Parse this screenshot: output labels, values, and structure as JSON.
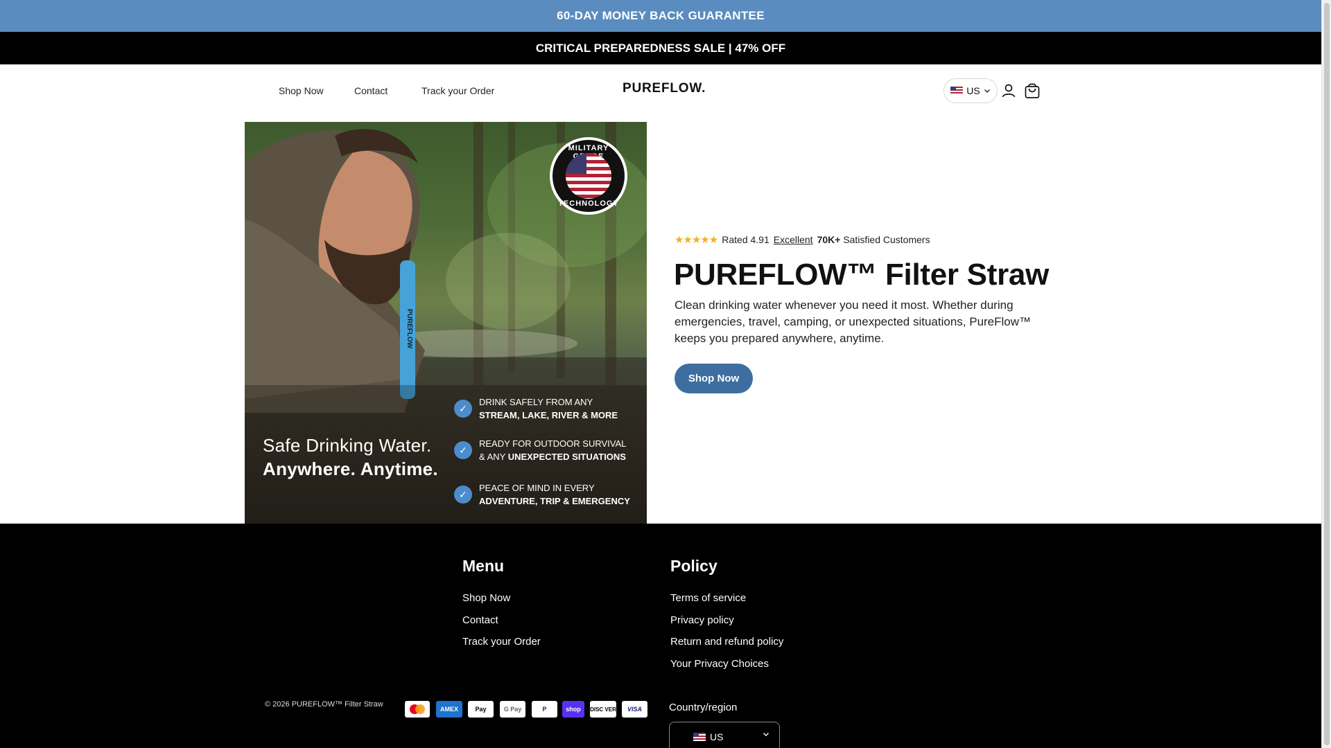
{
  "announcement": {
    "top": "60-DAY MONEY BACK GUARANTEE",
    "sale": "CRITICAL PREPAREDNESS SALE | 47% OFF"
  },
  "header": {
    "nav": [
      "Shop Now",
      "Contact",
      "Track your Order"
    ],
    "logo": "PUREFLOW.",
    "locale": "US",
    "icons": [
      "account-icon",
      "cart-icon"
    ]
  },
  "hero": {
    "image": {
      "badge_top": "MILITARY GRADE",
      "badge_bottom": "TECHNOLOGY",
      "straw_label": "PUREFLOW",
      "tagline_line1": "Safe Drinking Water.",
      "tagline_line2": "Anywhere. Anytime.",
      "features": [
        {
          "line1": "DRINK SAFELY FROM ANY",
          "line2": "STREAM, LAKE, RIVER & MORE"
        },
        {
          "line1": "READY FOR OUTDOOR SURVIVAL",
          "line2_prefix": "& ANY ",
          "line2": "UNEXPECTED SITUATIONS"
        },
        {
          "line1": "PEACE OF MIND IN EVERY",
          "line2": "ADVENTURE, TRIP & EMERGENCY"
        }
      ]
    },
    "rating": {
      "stars": "★★★★★",
      "prefix": "Rated 4.91",
      "excellent": "Excellent",
      "count": "70K+",
      "suffix": "Satisfied Customers",
      "value": 4.91
    },
    "title": "PUREFLOW™ Filter Straw",
    "description": "Clean drinking water whenever you need it most. Whether during emergencies, travel, camping, or unexpected situations, PureFlow™ keeps you prepared anywhere, anytime.",
    "cta": "Shop Now"
  },
  "footer": {
    "menu_heading": "Menu",
    "menu": [
      "Shop Now",
      "Contact",
      "Track your Order"
    ],
    "policy_heading": "Policy",
    "policy": [
      "Terms of service",
      "Privacy policy",
      "Return and refund policy",
      "Your Privacy Choices"
    ],
    "copyright": "© 2026 PUREFLOW™ Filter Straw",
    "payments": [
      "Mastercard",
      "American Express",
      "Apple Pay",
      "Google Pay",
      "PayPal",
      "Shop Pay",
      "Discover",
      "Visa"
    ],
    "payment_labels": {
      "amex": "AMEX",
      "applepay": "Pay",
      "googlepay": "G Pay",
      "paypal": "P",
      "shoppay": "shop",
      "discover": "DISC VER",
      "visa": "VISA"
    },
    "country_label": "Country/region",
    "country_value": "US"
  },
  "colors": {
    "announcement_bg": "#5a8cc0",
    "sale_bg": "#000000",
    "cta_bg": "#3d6e9f",
    "star": "#f2b01e",
    "footer_bg": "#000000"
  }
}
